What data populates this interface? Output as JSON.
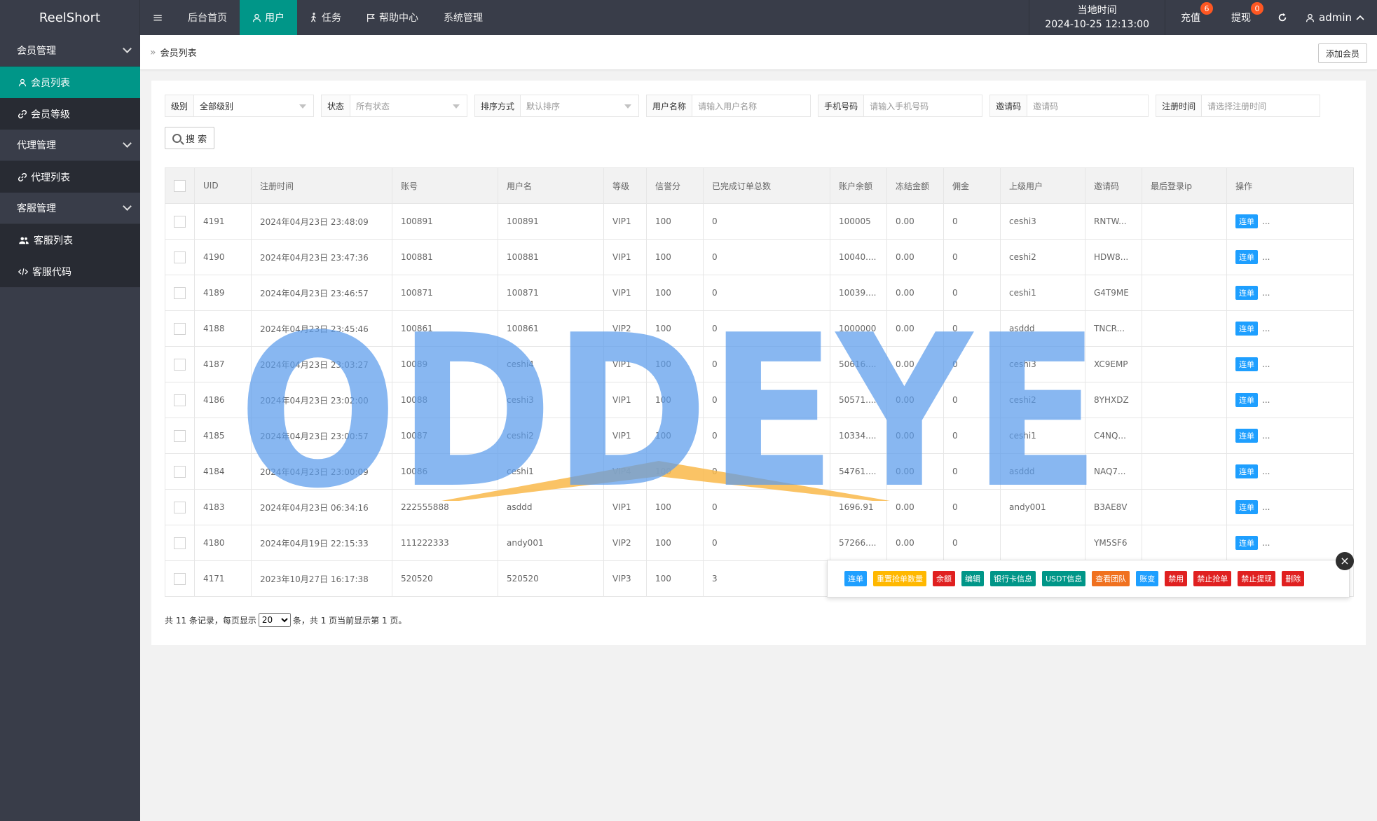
{
  "app": {
    "title": "ReelShort"
  },
  "topnav": {
    "items": [
      {
        "label": "后台首页",
        "active": false,
        "icon": ""
      },
      {
        "label": "用户",
        "active": true,
        "icon": "user-icon"
      },
      {
        "label": "任务",
        "active": false,
        "icon": "walk-icon"
      },
      {
        "label": "帮助中心",
        "active": false,
        "icon": "flag-icon"
      },
      {
        "label": "系统管理",
        "active": false,
        "icon": ""
      }
    ],
    "time_label": "当地时间",
    "time_value": "2024-10-25 12:13:00",
    "recharge_label": "充值",
    "recharge_badge": "6",
    "withdraw_label": "提现",
    "withdraw_badge": "0",
    "user_label": "admin"
  },
  "sidebar": {
    "groups": [
      {
        "label": "会员管理",
        "items": [
          {
            "label": "会员列表",
            "icon": "user-icon",
            "active": true
          },
          {
            "label": "会员等级",
            "icon": "link-icon",
            "active": false
          }
        ]
      },
      {
        "label": "代理管理",
        "items": [
          {
            "label": "代理列表",
            "icon": "link-icon",
            "active": false
          }
        ]
      },
      {
        "label": "客服管理",
        "items": [
          {
            "label": "客服列表",
            "icon": "users-icon",
            "active": false
          },
          {
            "label": "客服代码",
            "icon": "code-icon",
            "active": false
          }
        ]
      }
    ]
  },
  "breadcrumb": {
    "sep": "»",
    "current": "会员列表",
    "add_button": "添加会员"
  },
  "filters": {
    "level": {
      "label": "级别",
      "value": "全部级别"
    },
    "status": {
      "label": "状态",
      "placeholder": "所有状态"
    },
    "sort": {
      "label": "排序方式",
      "placeholder": "默认排序"
    },
    "username": {
      "label": "用户名称",
      "placeholder": "请输入用户名称"
    },
    "phone": {
      "label": "手机号码",
      "placeholder": "请输入手机号码"
    },
    "invite": {
      "label": "邀请码",
      "placeholder": "邀请码"
    },
    "regtime": {
      "label": "注册时间",
      "placeholder": "请选择注册时间"
    },
    "search_button": "搜 索"
  },
  "table": {
    "columns": [
      "UID",
      "注册时间",
      "账号",
      "用户名",
      "等级",
      "信誉分",
      "已完成订单总数",
      "账户余额",
      "冻结金额",
      "佣金",
      "上级用户",
      "邀请码",
      "最后登录ip",
      "操作"
    ],
    "rows": [
      [
        "4191",
        "2024年04月23日 23:48:09",
        "100891",
        "100891",
        "VIP1",
        "100",
        "0",
        "100005",
        "0.00",
        "0",
        "ceshi3",
        "RNTW...",
        ""
      ],
      [
        "4190",
        "2024年04月23日 23:47:36",
        "100881",
        "100881",
        "VIP1",
        "100",
        "0",
        "10040....",
        "0.00",
        "0",
        "ceshi2",
        "HDW8...",
        ""
      ],
      [
        "4189",
        "2024年04月23日 23:46:57",
        "100871",
        "100871",
        "VIP1",
        "100",
        "0",
        "10039....",
        "0.00",
        "0",
        "ceshi1",
        "G4T9ME",
        ""
      ],
      [
        "4188",
        "2024年04月23日 23:45:46",
        "100861",
        "100861",
        "VIP2",
        "100",
        "0",
        "1000000",
        "0.00",
        "0",
        "asddd",
        "TNCR...",
        ""
      ],
      [
        "4187",
        "2024年04月23日 23:03:27",
        "10089",
        "ceshi4",
        "VIP1",
        "100",
        "0",
        "50616....",
        "0.00",
        "0",
        "ceshi3",
        "XC9EMP",
        ""
      ],
      [
        "4186",
        "2024年04月23日 23:02:00",
        "10088",
        "ceshi3",
        "VIP1",
        "100",
        "0",
        "50571....",
        "0.00",
        "0",
        "ceshi2",
        "8YHXDZ",
        ""
      ],
      [
        "4185",
        "2024年04月23日 23:00:57",
        "10087",
        "ceshi2",
        "VIP1",
        "100",
        "0",
        "10334....",
        "0.00",
        "0",
        "ceshi1",
        "C4NQ...",
        ""
      ],
      [
        "4184",
        "2024年04月23日 23:00:09",
        "10086",
        "ceshi1",
        "VIP4",
        "100",
        "0",
        "54761....",
        "0.00",
        "0",
        "asddd",
        "NAQ7...",
        ""
      ],
      [
        "4183",
        "2024年04月23日 06:34:16",
        "222555888",
        "asddd",
        "VIP1",
        "100",
        "0",
        "1696.91",
        "0.00",
        "0",
        "andy001",
        "B3AE8V",
        ""
      ],
      [
        "4180",
        "2024年04月19日 22:15:33",
        "111222333",
        "andy001",
        "VIP2",
        "100",
        "0",
        "57266....",
        "0.00",
        "0",
        "",
        "YM5SF6",
        ""
      ],
      [
        "4171",
        "2023年10月27日 16:17:38",
        "520520",
        "520520",
        "VIP3",
        "100",
        "3",
        "",
        "",
        "",
        "",
        "",
        ""
      ]
    ],
    "op_label": "连单",
    "op_more": "..."
  },
  "pagination": {
    "prefix": "共 11 条记录，每页显示",
    "page_size": "20",
    "page_size_options": [
      "20"
    ],
    "suffix": "条，共 1 页当前显示第 1 页。"
  },
  "popup": {
    "buttons": [
      {
        "label": "连单",
        "color": "#1e9fff"
      },
      {
        "label": "重置抢单数量",
        "color": "#ffb800"
      },
      {
        "label": "余额",
        "color": "#e02020"
      },
      {
        "label": "编辑",
        "color": "#009688"
      },
      {
        "label": "银行卡信息",
        "color": "#009688"
      },
      {
        "label": "USDT信息",
        "color": "#009688"
      },
      {
        "label": "查看团队",
        "color": "#f0711f"
      },
      {
        "label": "账变",
        "color": "#1e9fff"
      },
      {
        "label": "禁用",
        "color": "#e02020"
      },
      {
        "label": "禁止抢单",
        "color": "#e02020"
      },
      {
        "label": "禁止提现",
        "color": "#e02020"
      },
      {
        "label": "删除",
        "color": "#e02020"
      }
    ],
    "close_label": "×"
  },
  "watermark": {
    "text": "ODDEYE",
    "letter_color": "#5b9cec",
    "roof_color": "#f9b94a"
  },
  "colors": {
    "accent": "#009688",
    "dark": "#393d49",
    "blue": "#1e9fff"
  }
}
